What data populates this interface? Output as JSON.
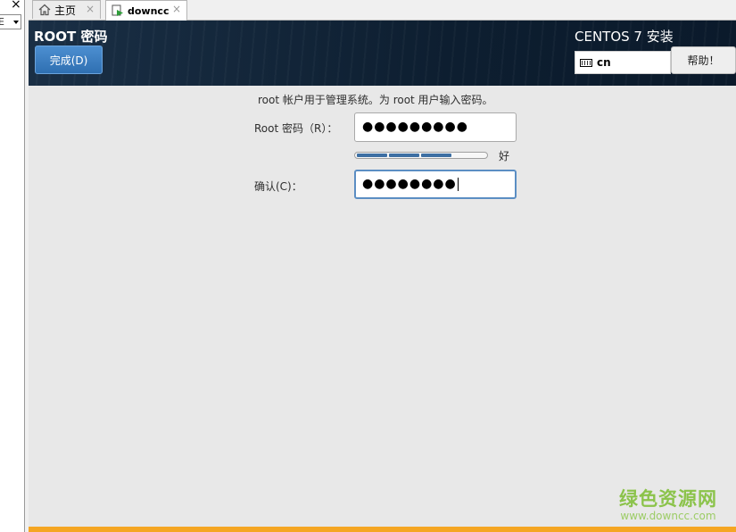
{
  "side_panel": {
    "close_glyph": "×",
    "select_value": "E"
  },
  "tabs": [
    {
      "label": "主页",
      "icon": "home-icon",
      "close": "×"
    },
    {
      "label": "downcc",
      "icon": "vm-icon",
      "close": "×"
    }
  ],
  "header": {
    "title": "ROOT 密码",
    "done_label": "完成(D)",
    "product": "CENTOS 7 安装",
    "keyboard_layout": "cn",
    "help_label": "帮助！"
  },
  "form": {
    "description": "root 帐户用于管理系统。为 root 用户输入密码。",
    "root_label": "Root 密码（R）：",
    "root_value": "●●●●●●●●●",
    "strength_fraction": 0.75,
    "strength_text": "好",
    "confirm_label": "确认(C)：",
    "confirm_value": "●●●●●●●●"
  },
  "watermark": {
    "text": "绿色资源网",
    "url": "www.downcc.com"
  },
  "colors": {
    "header_bg": "#0d1e30",
    "done_button": "#3a7fc1",
    "strength_fill": "#3d6fa3",
    "bottom_bar": "#f5a623",
    "watermark": "#8bc34a"
  }
}
